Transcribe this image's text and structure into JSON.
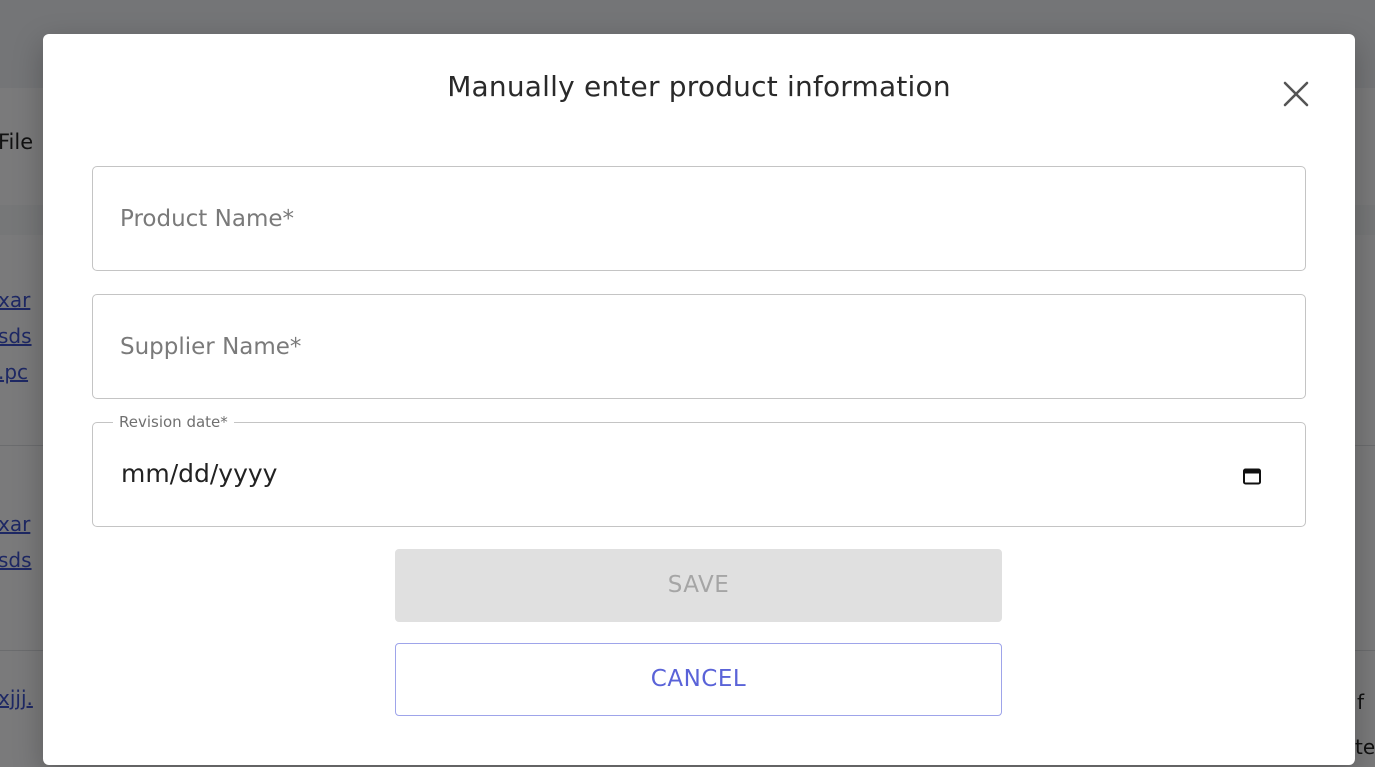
{
  "background": {
    "heading_fragment": "File",
    "link_fragments": [
      "xar",
      "sds",
      ".pc",
      "xar",
      "sds",
      "xjjj."
    ],
    "right_fragments": [
      "f",
      "te"
    ]
  },
  "dialog": {
    "title": "Manually enter product information",
    "close_icon": "close-icon",
    "product_name": {
      "placeholder": "Product Name*",
      "value": ""
    },
    "supplier_name": {
      "placeholder": "Supplier Name*",
      "value": ""
    },
    "revision_date": {
      "label": "Revision date*",
      "value": "mm/dd/yyyy",
      "icon": "calendar-icon"
    },
    "save_label": "SAVE",
    "cancel_label": "CANCEL"
  },
  "colors": {
    "accent": "#5a63d8",
    "disabled_bg": "#e0e0e0",
    "disabled_text": "#a5a5a5",
    "link": "#3c50c8"
  }
}
